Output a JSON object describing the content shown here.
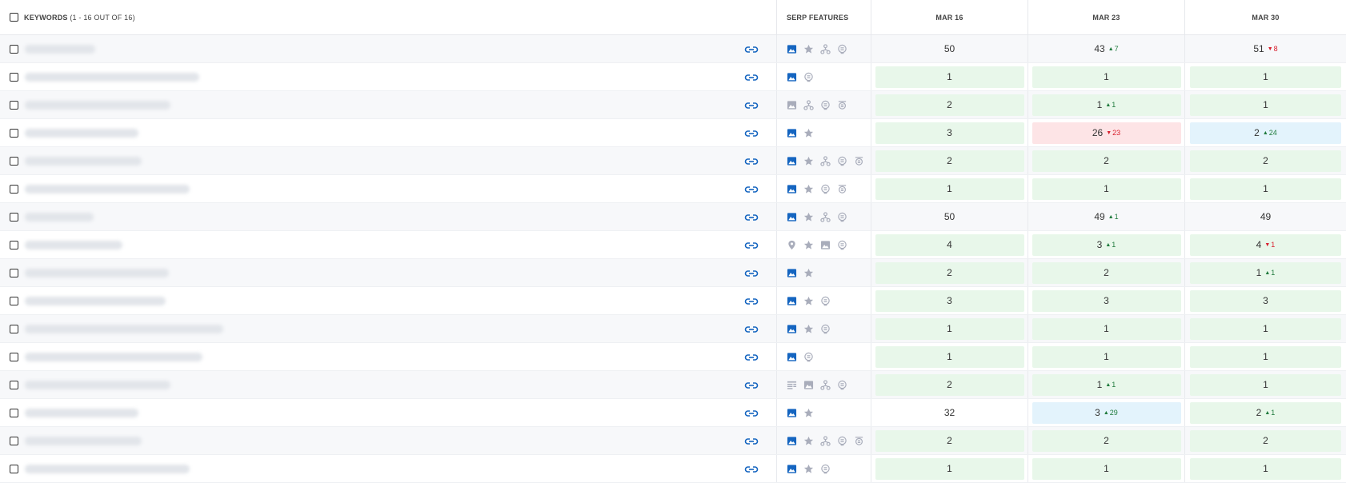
{
  "header": {
    "keywords_label": "KEYWORDS",
    "keywords_count": "(1 - 16 OUT OF 16)",
    "serp_label": "SERP FEATURES",
    "dates": [
      "MAR 16",
      "MAR 23",
      "MAR 30"
    ]
  },
  "colors": {
    "image_active": "#1565c0",
    "feature_inactive": "#a9adbb",
    "link": "#1565c0",
    "up": "#1e7a3c",
    "down": "#d8202e"
  },
  "rows": [
    {
      "features": [
        "image-active",
        "star",
        "sitelinks",
        "featured-snippet"
      ],
      "cells": [
        {
          "v": "50",
          "bg": "none"
        },
        {
          "v": "43",
          "bg": "none",
          "chg": "7",
          "dir": "up"
        },
        {
          "v": "51",
          "bg": "none",
          "chg": "8",
          "dir": "down"
        }
      ]
    },
    {
      "features": [
        "image-active",
        "featured-snippet"
      ],
      "cells": [
        {
          "v": "1",
          "bg": "green"
        },
        {
          "v": "1",
          "bg": "green"
        },
        {
          "v": "1",
          "bg": "green"
        }
      ]
    },
    {
      "features": [
        "image-gray",
        "sitelinks",
        "featured-snippet",
        "video"
      ],
      "cells": [
        {
          "v": "2",
          "bg": "green"
        },
        {
          "v": "1",
          "bg": "green",
          "chg": "1",
          "dir": "up"
        },
        {
          "v": "1",
          "bg": "green"
        }
      ]
    },
    {
      "features": [
        "image-active",
        "star"
      ],
      "cells": [
        {
          "v": "3",
          "bg": "green"
        },
        {
          "v": "26",
          "bg": "red",
          "chg": "23",
          "dir": "down"
        },
        {
          "v": "2",
          "bg": "blue",
          "chg": "24",
          "dir": "up"
        }
      ]
    },
    {
      "features": [
        "image-active",
        "star",
        "sitelinks",
        "featured-snippet",
        "video"
      ],
      "cells": [
        {
          "v": "2",
          "bg": "green"
        },
        {
          "v": "2",
          "bg": "green"
        },
        {
          "v": "2",
          "bg": "green"
        }
      ]
    },
    {
      "features": [
        "image-active",
        "star",
        "featured-snippet",
        "video"
      ],
      "cells": [
        {
          "v": "1",
          "bg": "green"
        },
        {
          "v": "1",
          "bg": "green"
        },
        {
          "v": "1",
          "bg": "green"
        }
      ]
    },
    {
      "features": [
        "image-active",
        "star",
        "sitelinks",
        "featured-snippet"
      ],
      "cells": [
        {
          "v": "50",
          "bg": "none"
        },
        {
          "v": "49",
          "bg": "none",
          "chg": "1",
          "dir": "up"
        },
        {
          "v": "49",
          "bg": "none"
        }
      ]
    },
    {
      "features": [
        "location",
        "star",
        "image-gray",
        "featured-snippet"
      ],
      "cells": [
        {
          "v": "4",
          "bg": "green"
        },
        {
          "v": "3",
          "bg": "green",
          "chg": "1",
          "dir": "up"
        },
        {
          "v": "4",
          "bg": "green",
          "chg": "1",
          "dir": "down"
        }
      ]
    },
    {
      "features": [
        "image-active",
        "star"
      ],
      "cells": [
        {
          "v": "2",
          "bg": "green"
        },
        {
          "v": "2",
          "bg": "green"
        },
        {
          "v": "1",
          "bg": "green",
          "chg": "1",
          "dir": "up"
        }
      ]
    },
    {
      "features": [
        "image-active",
        "star",
        "featured-snippet"
      ],
      "cells": [
        {
          "v": "3",
          "bg": "green"
        },
        {
          "v": "3",
          "bg": "green"
        },
        {
          "v": "3",
          "bg": "green"
        }
      ]
    },
    {
      "features": [
        "image-active",
        "star",
        "featured-snippet"
      ],
      "cells": [
        {
          "v": "1",
          "bg": "green"
        },
        {
          "v": "1",
          "bg": "green"
        },
        {
          "v": "1",
          "bg": "green"
        }
      ]
    },
    {
      "features": [
        "image-active",
        "featured-snippet"
      ],
      "cells": [
        {
          "v": "1",
          "bg": "green"
        },
        {
          "v": "1",
          "bg": "green"
        },
        {
          "v": "1",
          "bg": "green"
        }
      ]
    },
    {
      "features": [
        "list",
        "image-gray",
        "sitelinks",
        "featured-snippet"
      ],
      "cells": [
        {
          "v": "2",
          "bg": "green"
        },
        {
          "v": "1",
          "bg": "green",
          "chg": "1",
          "dir": "up"
        },
        {
          "v": "1",
          "bg": "green"
        }
      ]
    },
    {
      "features": [
        "image-active",
        "star"
      ],
      "cells": [
        {
          "v": "32",
          "bg": "none"
        },
        {
          "v": "3",
          "bg": "blue",
          "chg": "29",
          "dir": "up"
        },
        {
          "v": "2",
          "bg": "green",
          "chg": "1",
          "dir": "up"
        }
      ]
    },
    {
      "features": [
        "image-active",
        "star",
        "sitelinks",
        "featured-snippet",
        "video"
      ],
      "cells": [
        {
          "v": "2",
          "bg": "green"
        },
        {
          "v": "2",
          "bg": "green"
        },
        {
          "v": "2",
          "bg": "green"
        }
      ]
    },
    {
      "features": [
        "image-active",
        "star",
        "featured-snippet"
      ],
      "cells": [
        {
          "v": "1",
          "bg": "green"
        },
        {
          "v": "1",
          "bg": "green"
        },
        {
          "v": "1",
          "bg": "green"
        }
      ]
    }
  ]
}
